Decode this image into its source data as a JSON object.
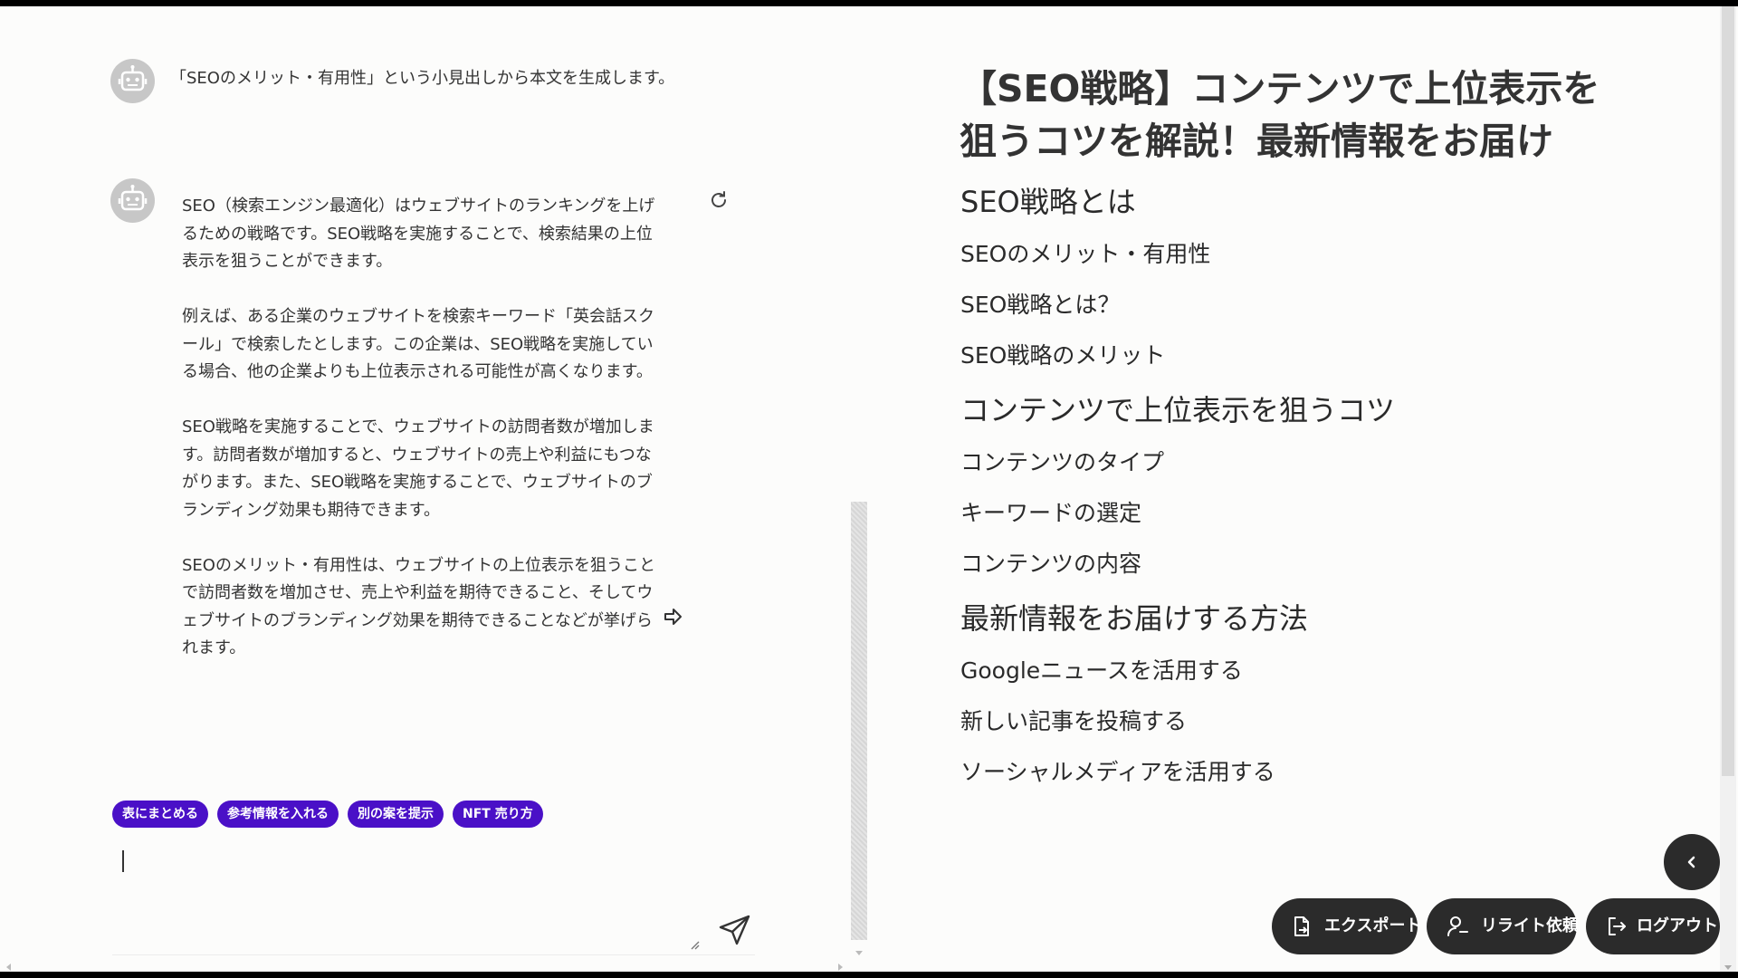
{
  "chat": {
    "messages": [
      {
        "id": "msg1",
        "text": "「SEOのメリット・有用性」という小見出しから本文を生成します。"
      },
      {
        "id": "msg2",
        "paragraphs": [
          "SEO（検索エンジン最適化）はウェブサイトのランキングを上げるための戦略です。SEO戦略を実施することで、検索結果の上位表示を狙うことができます。",
          "例えば、ある企業のウェブサイトを検索キーワード「英会話スクール」で検索したとします。この企業は、SEO戦略を実施している場合、他の企業よりも上位表示される可能性が高くなります。",
          "SEO戦略を実施することで、ウェブサイトの訪問者数が増加します。訪問者数が増加すると、ウェブサイトの売上や利益にもつながります。また、SEO戦略を実施することで、ウェブサイトのブランディング効果も期待できます。",
          "SEOのメリット・有用性は、ウェブサイトの上位表示を狙うことで訪問者数を増加させ、売上や利益を期待できること、そしてウェブサイトのブランディング効果を期待できることなどが挙げられます。"
        ]
      }
    ],
    "chips": [
      "表にまとめる",
      "参考情報を入れる",
      "別の案を提示",
      "NFT 売り方"
    ],
    "input": {
      "value": "",
      "placeholder": ""
    }
  },
  "outline": {
    "title": "【SEO戦略】コンテンツで上位表示を狙うコツを解説！最新情報をお届け",
    "sections": [
      {
        "heading": "SEO戦略とは",
        "subheadings": [
          "SEOのメリット・有用性",
          "SEO戦略とは？",
          "SEO戦略のメリット"
        ]
      },
      {
        "heading": "コンテンツで上位表示を狙うコツ",
        "subheadings": [
          "コンテンツのタイプ",
          "キーワードの選定",
          "コンテンツの内容"
        ]
      },
      {
        "heading": "最新情報をお届けする方法",
        "subheadings": [
          "Googleニュースを活用する",
          "新しい記事を投稿する",
          "ソーシャルメディアを活用する"
        ]
      }
    ]
  },
  "actions": {
    "export_label": "エクスポート",
    "rewrite_label": "リライト依頼",
    "logout_label": "ログアウト"
  },
  "icons": {
    "avatar": "robot-icon",
    "regenerate": "refresh-icon",
    "forward": "forward-arrow-icon",
    "send": "send-icon",
    "collapse": "chevron-left-icon",
    "export": "file-export-icon",
    "rewrite": "user-edit-icon",
    "logout": "logout-icon"
  },
  "colors": {
    "chip_bg": "#4a10c7",
    "button_bg": "#2b2b2b",
    "page_bg": "#fcfcfb"
  }
}
